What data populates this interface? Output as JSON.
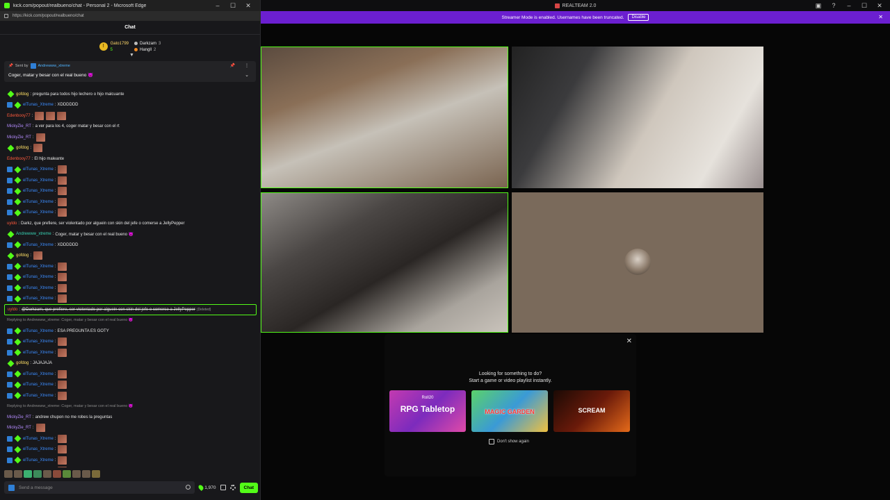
{
  "popout": {
    "window_title": "kick.com/popout/realbueno/chat - Personal 2 - Microsoft Edge",
    "url": "https://kick.com/popout/realbueno/chat",
    "chat_header": "Chat",
    "leaderboard": {
      "gold_name": "Gato1799",
      "gold_count": "5",
      "rows": [
        {
          "name": "Darkzam",
          "count": "3"
        },
        {
          "name": "Hangll",
          "count": "2"
        }
      ]
    },
    "pinned": {
      "sent_by_label": "Sent by",
      "sender": "Andrewww_xtreme",
      "message": "Coger, matar y besar con el real bueno 😈"
    },
    "messages": [
      {
        "user": "gofdog",
        "color": "yellow",
        "text": "pregunta para todos hijo lechero o hijo malcuante",
        "badges": 1
      },
      {
        "user": "elTunas_Xtreme",
        "color": "blue",
        "text": "XDDDDDD",
        "badges": 2
      },
      {
        "user": "Edenbooy77",
        "color": "red",
        "text": "",
        "emotes": 3,
        "badges": 0
      },
      {
        "user": "MickyZie_RT",
        "color": "purple",
        "text": "a ver para los 4, coger matar y besar con el rt",
        "badges": 0
      },
      {
        "user": "MickyZie_RT",
        "color": "purple",
        "text": "",
        "emotes": 1,
        "badges": 0
      },
      {
        "user": "gofdog",
        "color": "yellow",
        "text": "",
        "emotes": 1,
        "badges": 1
      },
      {
        "user": "Edenbooy77",
        "color": "red",
        "text": "El hijo maleante",
        "badges": 0
      },
      {
        "user": "elTunas_Xtreme",
        "color": "blue",
        "text": "",
        "emotes": 1,
        "badges": 2
      },
      {
        "user": "elTunas_Xtreme",
        "color": "blue",
        "text": "",
        "emotes": 1,
        "badges": 2
      },
      {
        "user": "elTunas_Xtreme",
        "color": "blue",
        "text": "",
        "emotes": 1,
        "badges": 2
      },
      {
        "user": "elTunas_Xtreme",
        "color": "blue",
        "text": "",
        "emotes": 1,
        "badges": 2
      },
      {
        "user": "elTunas_Xtreme",
        "color": "blue",
        "text": "",
        "emotes": 1,
        "badges": 2
      },
      {
        "user": "uyldo",
        "color": "red",
        "text": "Darkz, que prefiere, ser violentado por alguein con skin del jefe o comerse a JellyPepper",
        "badges": 0
      },
      {
        "user": "Andrewww_xtreme",
        "color": "teal",
        "text": "Coger, matar y besar con el real bueno 😈",
        "badges": 1
      },
      {
        "user": "elTunas_Xtreme",
        "color": "blue",
        "text": "XDDDDDD",
        "badges": 2
      },
      {
        "user": "gofdog",
        "color": "yellow",
        "text": "",
        "emotes": 1,
        "badges": 1
      },
      {
        "user": "elTunas_Xtreme",
        "color": "blue",
        "text": "",
        "emotes": 1,
        "badges": 2
      },
      {
        "user": "elTunas_Xtreme",
        "color": "blue",
        "text": "",
        "emotes": 1,
        "badges": 2
      },
      {
        "user": "elTunas_Xtreme",
        "color": "blue",
        "text": "",
        "emotes": 1,
        "badges": 2
      },
      {
        "user": "elTunas_Xtreme",
        "color": "blue",
        "text": "",
        "emotes": 1,
        "badges": 2
      },
      {
        "user": "uyldo",
        "color": "red",
        "text": "@Darkzam, que prefiere, ser violentado por alguein con skin del jefe o comerse a JellyPepper",
        "deleted": "(Deleted)",
        "highlight": true,
        "badges": 0
      },
      {
        "reply": "Replying to Andrewww_xtreme: Coger, matar y besar con el real bueno 😈"
      },
      {
        "user": "elTunas_Xtreme",
        "color": "blue",
        "text": "ESA PREGUNTA ES GOTY",
        "badges": 2
      },
      {
        "user": "elTunas_Xtreme",
        "color": "blue",
        "text": "",
        "emotes": 1,
        "badges": 2
      },
      {
        "user": "elTunas_Xtreme",
        "color": "blue",
        "text": "",
        "emotes": 1,
        "badges": 2
      },
      {
        "user": "gofdog",
        "color": "yellow",
        "text": "JAJAJAJA",
        "badges": 1
      },
      {
        "user": "elTunas_Xtreme",
        "color": "blue",
        "text": "",
        "emotes": 1,
        "badges": 2
      },
      {
        "user": "elTunas_Xtreme",
        "color": "blue",
        "text": "",
        "emotes": 1,
        "badges": 2
      },
      {
        "user": "elTunas_Xtreme",
        "color": "blue",
        "text": "",
        "emotes": 1,
        "badges": 2
      },
      {
        "reply": "Replying to Andrewww_xtreme: Coger, matar y besar con el real bueno 😈"
      },
      {
        "user": "MickyZie_RT",
        "color": "purple",
        "text": "andrew chupon no me robes la preguntas",
        "badges": 0
      },
      {
        "user": "MickyZie_RT",
        "color": "purple",
        "text": "",
        "emotes": 1,
        "badges": 0
      },
      {
        "user": "elTunas_Xtreme",
        "color": "blue",
        "text": "",
        "emotes": 1,
        "badges": 2
      },
      {
        "user": "elTunas_Xtreme",
        "color": "blue",
        "text": "",
        "emotes": 1,
        "badges": 2
      },
      {
        "user": "elTunas_Xtreme",
        "color": "blue",
        "text": "",
        "emotes": 1,
        "badges": 2
      },
      {
        "user": "elTunas_Xtreme",
        "color": "blue",
        "text": "",
        "emotes": 1,
        "badges": 2
      }
    ],
    "send_placeholder": "Send a message",
    "points": "1,970",
    "chat_button": "Chat"
  },
  "main": {
    "window_title": "REALTEAM 2.0",
    "banner_text": "Streamer Mode is enabled. Usernames have been truncated.",
    "banner_button": "Disable",
    "suggest": {
      "line1": "Looking for something to do?",
      "line2": "Start a game or video playlist instantly.",
      "cards": [
        {
          "small": "Roll20",
          "label": "RPG Tabletop"
        },
        {
          "small": "",
          "label": "MAGIC GARDEN"
        },
        {
          "small": "",
          "label": "SCREAM"
        }
      ],
      "dont_show": "Don't show again"
    }
  },
  "colors": {
    "kick_green": "#53fc18",
    "banner_purple": "#6b1fd0"
  }
}
